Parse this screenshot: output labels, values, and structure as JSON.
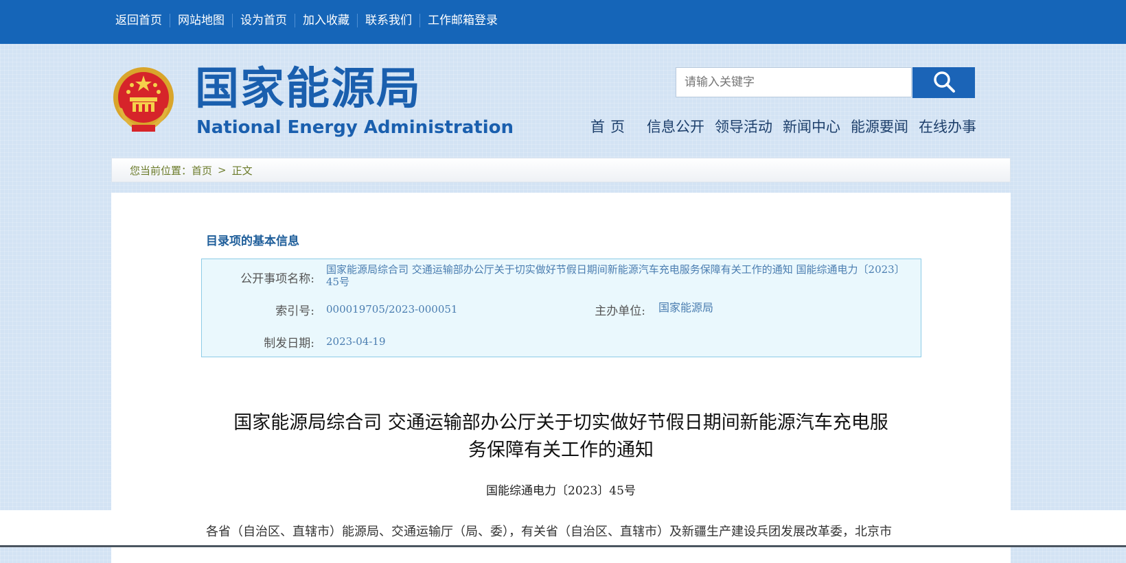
{
  "topnav": {
    "items": [
      "返回首页",
      "网站地图",
      "设为首页",
      "加入收藏",
      "联系我们",
      "工作邮箱登录"
    ]
  },
  "header": {
    "title": "国家能源局",
    "subtitle": "National Energy Administration",
    "emblem_icon": "national-emblem-icon"
  },
  "search": {
    "placeholder": "请输入关键字",
    "button_icon": "search-icon"
  },
  "mainnav": {
    "items": [
      "首页",
      "信息公开",
      "领导活动",
      "新闻中心",
      "能源要闻",
      "在线办事"
    ]
  },
  "breadcrumb": {
    "prefix": "您当前位置：",
    "home": "首页",
    "separator": ">",
    "current": "正文"
  },
  "info": {
    "heading": "目录项的基本信息",
    "name_label": "公开事项名称:",
    "name_value": "国家能源局综合司 交通运输部办公厅关于切实做好节假日期间新能源汽车充电服务保障有关工作的通知 国能综通电力〔2023〕45号",
    "index_label": "索引号:",
    "index_value": "000019705/2023-000051",
    "unit_label": "主办单位:",
    "unit_value": "国家能源局",
    "date_label": "制发日期:",
    "date_value": "2023-04-19"
  },
  "document": {
    "title_line1": "国家能源局综合司 交通运输部办公厅关于切实做好节假日期间新能源汽车充电服",
    "title_line2": "务保障有关工作的通知",
    "number": "国能综通电力〔2023〕45号",
    "body_first_line": "各省（自治区、直辖市）能源局、交通运输厅（局、委），有关省（自治区、直辖市）及新疆生产建设兵团发展改革委，北京市"
  },
  "colors": {
    "topbar": "#1565b8",
    "brand": "#1a5fae",
    "accent_link": "#4a7db0",
    "info_bg": "#eaf8fd"
  }
}
